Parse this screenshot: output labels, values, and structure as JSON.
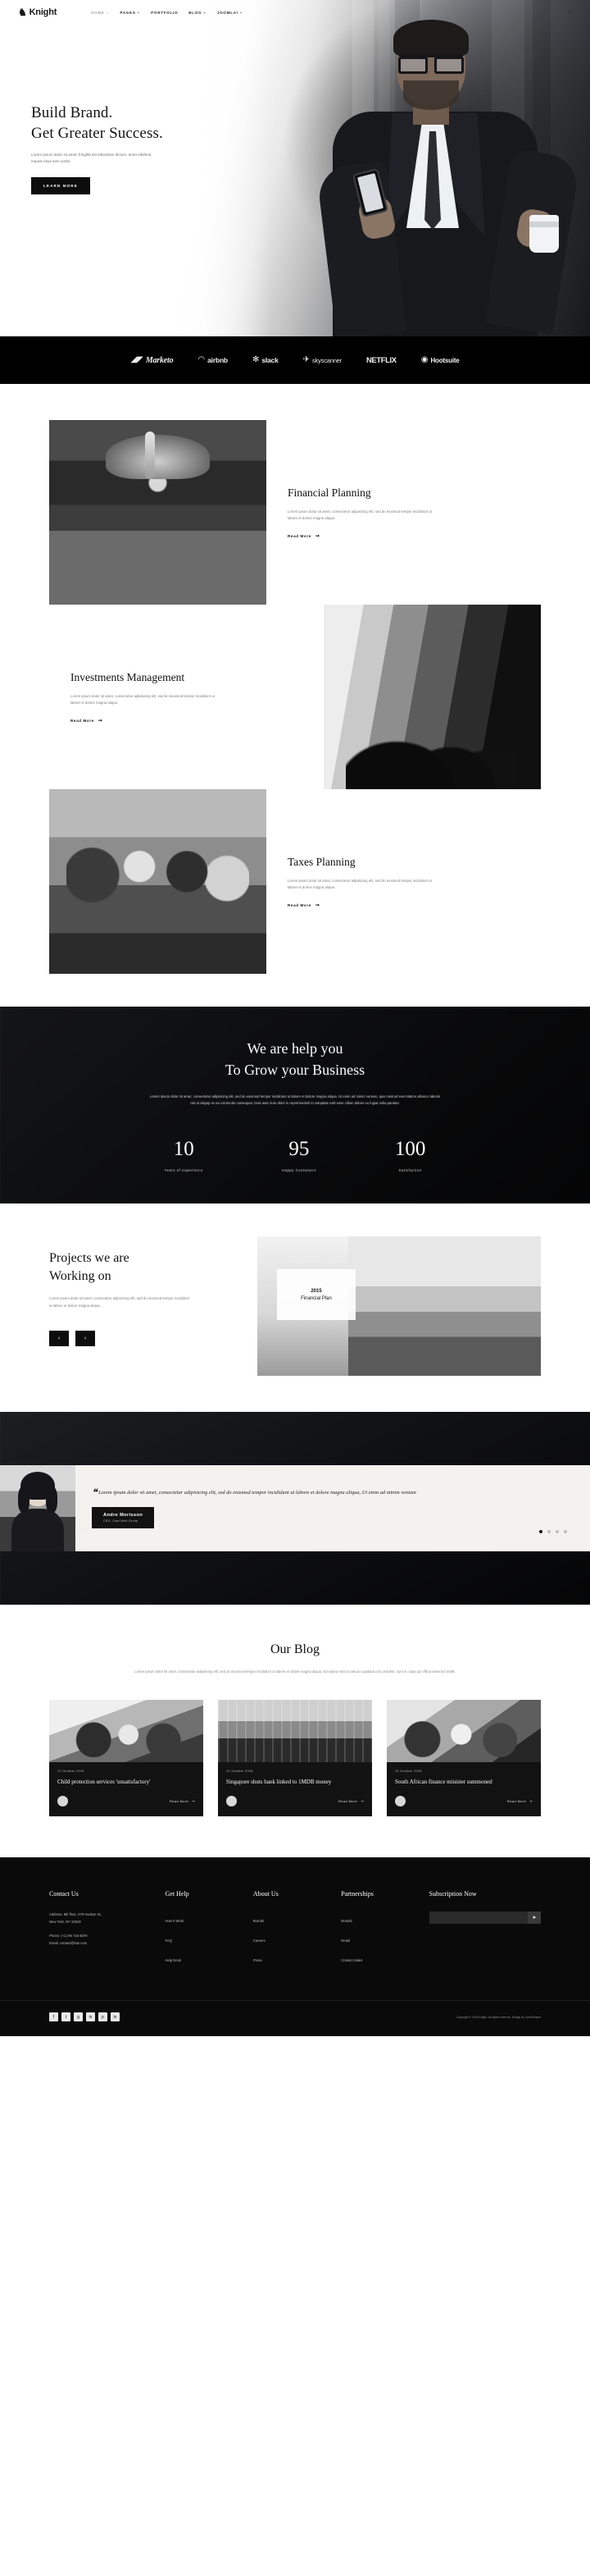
{
  "header": {
    "brand": "Knight",
    "brand_glyph": "♞",
    "nav": [
      {
        "label": "HOME",
        "caret": "⌄",
        "active": true
      },
      {
        "label": "PAGES",
        "caret": "⌄",
        "active": false
      },
      {
        "label": "PORTFOLIO",
        "caret": "",
        "active": false
      },
      {
        "label": "BLOG",
        "caret": "⌄",
        "active": false
      },
      {
        "label": "JOOMLA!",
        "caret": "⌄",
        "active": false
      }
    ],
    "search_icon": "⌕"
  },
  "hero": {
    "title_line1": "Build Brand.",
    "title_line2": "Get Greater Success.",
    "subtitle": "Lorem ipsum dolor sit amet, fringilla est bibendum dictum, amet eleifend mauris risus sem nimbl.",
    "cta": "LEARN MORE"
  },
  "logos": [
    {
      "name": "Marketo",
      "mark": "◢◤"
    },
    {
      "name": "airbnb",
      "mark": "◠"
    },
    {
      "name": "slack",
      "mark": "✻"
    },
    {
      "name": "skyscanner",
      "mark": "✈"
    },
    {
      "name": "NETFLIX",
      "mark": ""
    },
    {
      "name": "Hootsuite",
      "mark": "◉"
    }
  ],
  "services": [
    {
      "title": "Financial Planning",
      "body": "Lorem ipsum dolor sit amet, consectetur adipisicing elit, sed do eiusmod tempor incididunt ut labore et dolore magna aliqua.",
      "link": "Read More",
      "arrow": "➞",
      "image": "hands-holding-seedling"
    },
    {
      "title": "Investments Management",
      "body": "Lorem ipsum dolor sit amet, consectetur adipisicing elit, sed do eiusmod tempor incididunt ut labore et dolore magna aliqua.",
      "link": "Read More",
      "arrow": "➞",
      "image": "meeting-room-chairs"
    },
    {
      "title": "Taxes Planning",
      "body": "Lorem ipsum dolor sit amet, consectetur adipisicing elit, sed do eiusmod tempor incididunt ut labore et dolore magna aliqua.",
      "link": "Read More",
      "arrow": "➞",
      "image": "team-around-laptop"
    }
  ],
  "counters": {
    "title_line1": "We are help you",
    "title_line2": "To Grow your Business",
    "lead": "Lorem ipsum dolor sit amet, consectetur adipisicing elit, sed do eiusmod tempor incididunt ut labore et dolore magna aliqua. Ut enim ad minim veniam, quis nostrud exercitation ullamco laboris nisi ut aliquip ex ea commodo consequat. Duis aute irure dolor in reprehenderit in voluptate velit esse cillum dolore eu fugiat nulla pariatur.",
    "stats": [
      {
        "value": "10",
        "label": "Years of experience"
      },
      {
        "value": "95",
        "label": "Happy Costumers"
      },
      {
        "value": "100",
        "label": "Satisfaction"
      }
    ]
  },
  "projects": {
    "title_line1": "Projects we are",
    "title_line2": "Working on",
    "body": "Lorem ipsum dolor sit amet, consectetur adipisicing elit, sed do eiusmod tempor incididunt ut labore et dolore magna aliqua.",
    "prev": "‹",
    "next": "›",
    "card_year": "2015",
    "card_title": "Financial Plan"
  },
  "testimonial": {
    "big_quote": "❝",
    "open_quote": "❝",
    "text": "Lorem ipsum dolor sit amet, consectetur adipisicing elit, sed do eiusmod tempor incididunt ut labore et dolore magna aliqua, Ut enim ad minim veniam",
    "author": "Andre Morisson",
    "role": "CEO, Cast Next Group",
    "dots": 4,
    "active_dot": 0
  },
  "blog": {
    "title": "Our Blog",
    "lead": "Lorem ipsum dolor sit amet, consectetur adipisicing elit, sed do eiusmod tempor incididunt ut labore et dolore magna aliqua. Excepteur sint occaecat cupidatat non proident, sunt in culpa qui officia deserunt mollit.",
    "posts": [
      {
        "date": "12 October 2016",
        "title": "Child protection services 'unsatisfactory'",
        "read_more": "Read More",
        "arrow": "➞",
        "image": "business-people-talking"
      },
      {
        "date": "12 October 2016",
        "title": "Singapore shuts bank linked to 1MDB money",
        "read_more": "Read More",
        "arrow": "➞",
        "image": "city-bridge-structure"
      },
      {
        "date": "12 October 2016",
        "title": "South African finance minister summoned",
        "read_more": "Read More",
        "arrow": "➞",
        "image": "office-group-meeting"
      }
    ]
  },
  "footer": {
    "columns": [
      {
        "title": "Contact Us",
        "text": "Address: 8th floor, 379 Hudson St,\nNew York, NY 10018\n\nPhone: (+1) 96 716 6879\nEmail: contact@site.com",
        "links": []
      },
      {
        "title": "Get Help",
        "text": "",
        "links": [
          "How It Work",
          "FAQ",
          "Help Desk"
        ]
      },
      {
        "title": "About Us",
        "text": "",
        "links": [
          "Brands",
          "Careers",
          "Press"
        ]
      },
      {
        "title": "Partnerships",
        "text": "",
        "links": [
          "Brands",
          "Retail",
          "Contact Sales"
        ]
      }
    ],
    "subscription": {
      "title": "Subscription Now",
      "placeholder": "",
      "button_icon": "➤"
    },
    "social": [
      "f",
      "t",
      "g",
      "in",
      "p",
      "in"
    ],
    "copyright": "Copyright © 2016 Knight. All rights reserved. Design by JoomShaper"
  }
}
